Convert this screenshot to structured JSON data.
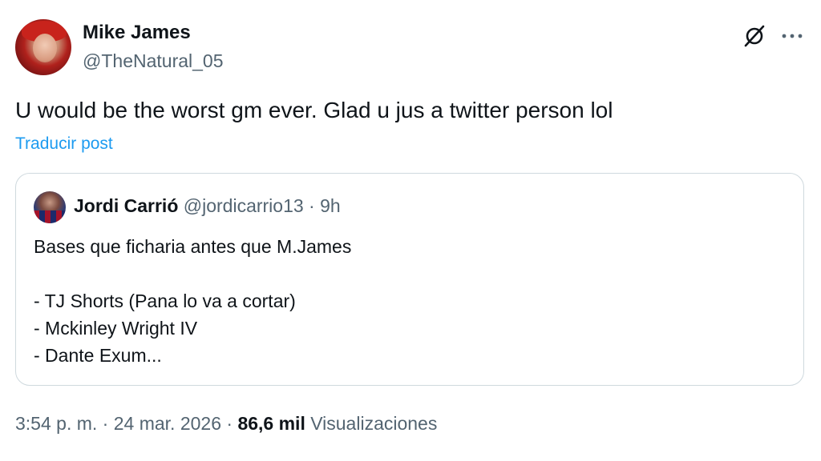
{
  "author": {
    "display_name": "Mike James",
    "handle": "@TheNatural_05"
  },
  "icons": {
    "grok": "grok-icon",
    "more": "more-options-icon"
  },
  "tweet": {
    "text": "U would be the worst gm ever. Glad u jus a twitter person lol",
    "translate_label": "Traducir post"
  },
  "quote": {
    "display_name": "Jordi Carrió",
    "handle": "@jordicarrio13",
    "separator": " · ",
    "time": "9h",
    "lines": [
      "Bases que ficharia antes que M.James",
      "",
      "- TJ Shorts (Pana lo va a cortar)",
      "- Mckinley Wright IV",
      "- Dante Exum..."
    ]
  },
  "meta": {
    "time": "3:54 p. m.",
    "separator": " · ",
    "date": "24 mar. 2026",
    "views_count": "86,6 mil",
    "views_label": "Visualizaciones"
  },
  "colors": {
    "text": "#0f1419",
    "secondary": "#536471",
    "link": "#1d9bf0",
    "border": "#cfd9de"
  }
}
